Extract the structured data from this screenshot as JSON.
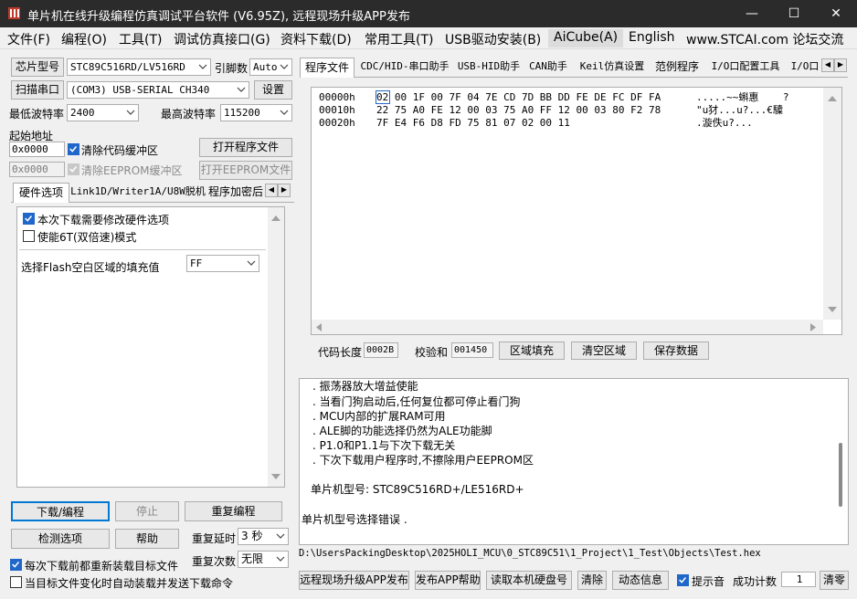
{
  "window": {
    "title": "单片机在线升级编程仿真调试平台软件 (V6.95Z), 远程现场升级APP发布",
    "minimize": "—",
    "maximize": "☐",
    "close": "✕"
  },
  "menu": [
    "文件(F)",
    "编程(O)",
    "工具(T)",
    "调试仿真接口(G)",
    "资料下载(D)",
    "常用工具(T)",
    "USB驱动安装(B)",
    "AiCube(A)",
    "English",
    "www.STCAI.com 论坛交流"
  ],
  "left": {
    "chip_label": "芯片型号",
    "chip_value": "STC89C516RD/LV516RD",
    "pins_label": "引脚数",
    "pins_value": "Auto",
    "scan_button": "扫描串口",
    "port_value": "(COM3) USB-SERIAL CH340",
    "settings_button": "设置",
    "min_baud_label": "最低波特率",
    "min_baud_value": "2400",
    "max_baud_label": "最高波特率",
    "max_baud_value": "115200",
    "start_addr_label": "起始地址",
    "code_addr": "0x0000",
    "clear_code_label": "清除代码缓冲区",
    "open_program_button": "打开程序文件",
    "eeprom_addr": "0x0000",
    "clear_eeprom_label": "清除EEPROM缓冲区",
    "open_eeprom_button": "打开EEPROM文件",
    "tabs": [
      "硬件选项",
      "Link1D/Writer1A/U8W脱机",
      "程序加密后"
    ],
    "hw_options": {
      "opt1": "本次下载需要修改硬件选项",
      "opt2": "使能6T(双倍速)模式",
      "fill_label": "选择Flash空白区域的填充值",
      "fill_value": "FF"
    },
    "download_button": "下载/编程",
    "stop_button": "停止",
    "reprogram_button": "重复编程",
    "check_button": "检测选项",
    "help_button": "帮助",
    "repeat_delay_label": "重复延时",
    "repeat_delay_value": "3 秒",
    "repeat_count_label": "重复次数",
    "repeat_count_value": "无限",
    "reload_label": "每次下载前都重新装载目标文件",
    "autosend_label": "当目标文件变化时自动装载并发送下载命令"
  },
  "right": {
    "tabs": [
      "程序文件",
      "CDC/HID-串口助手",
      "USB-HID助手",
      "CAN助手",
      "Keil仿真设置",
      "范例程序",
      "I/O口配置工具",
      "I/O口"
    ],
    "hex_rows": [
      {
        "addr": "00000h",
        "bytes": "02 00 1F 00 7F 04 7E CD 7D BB DD FE DE FC DF FA",
        "ascii": ".....~~蝌惠    ?"
      },
      {
        "addr": "00010h",
        "bytes": "22 75 A0 FE 12 00 03 75 A0 FF 12 00 03 80 F2 78",
        "ascii": "\"u犲...u?...€驝"
      },
      {
        "addr": "00020h",
        "bytes": "7F E4 F6 D8 FD 75 81 07 02 00 11",
        "ascii": ".漩佚u?..."
      }
    ],
    "code_len_label": "代码长度",
    "code_len_value": "0002B",
    "checksum_label": "校验和",
    "checksum_value": "001450",
    "fill_region_button": "区域填充",
    "clear_region_button": "清空区域",
    "save_data_button": "保存数据",
    "log_lines": [
      ". 振荡器放大增益使能",
      ". 当看门狗启动后,任何复位都可停止看门狗",
      ". MCU内部的扩展RAM可用",
      ". ALE脚的功能选择仍然为ALE功能脚",
      ". P1.0和P1.1与下次下载无关",
      ". 下次下载用户程序时,不擦除用户EEPROM区"
    ],
    "mcu_model_line": "单片机型号: STC89C516RD+/LE516RD+",
    "error_line": "单片机型号选择错误 .",
    "file_path": "D:\\UsersPackingDesktop\\2025HOLI_MCU\\0_STC89C51\\1_Project\\1_Test\\Objects\\Test.hex",
    "remote_button": "远程现场升级APP发布",
    "publish_help_button": "发布APP帮助",
    "read_disk_button": "读取本机硬盘号",
    "clear_button": "清除",
    "dynamic_button": "动态信息",
    "beep_label": "提示音",
    "success_label": "成功计数",
    "success_value": "1",
    "clear_count_button": "清零"
  }
}
